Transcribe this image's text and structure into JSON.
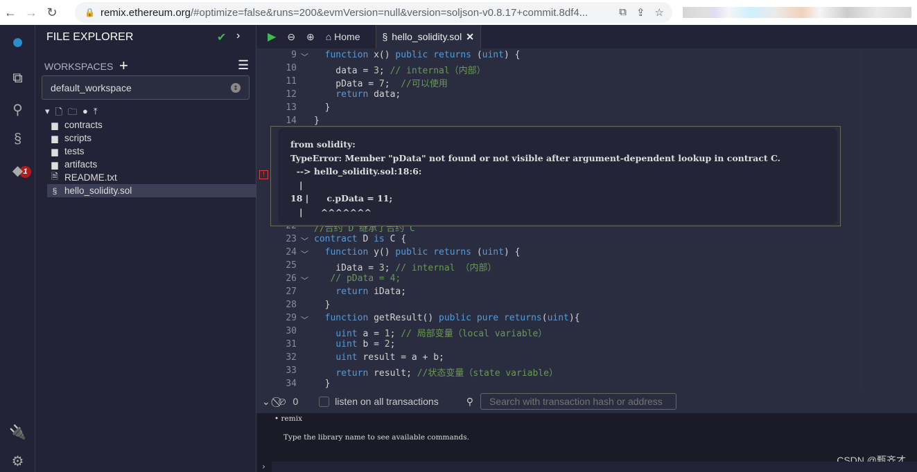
{
  "browser": {
    "url_host": "remix.ethereum.org",
    "url_rest": "/#optimize=false&runs=200&evmVersion=null&version=soljson-v0.8.17+commit.8df4..."
  },
  "iconbar": {
    "badge": "1"
  },
  "explorer": {
    "title": "FILE EXPLORER",
    "workspaces_label": "WORKSPACES",
    "workspace": "default_workspace",
    "items": [
      {
        "name": "contracts",
        "type": "folder"
      },
      {
        "name": "scripts",
        "type": "folder"
      },
      {
        "name": "tests",
        "type": "folder"
      },
      {
        "name": "artifacts",
        "type": "folder"
      },
      {
        "name": "README.txt",
        "type": "file"
      },
      {
        "name": "hello_solidity.sol",
        "type": "sol",
        "selected": true
      }
    ]
  },
  "editor": {
    "home_tab": "Home",
    "active_tab": "hello_solidity.sol",
    "lines": [
      {
        "n": "9",
        "fold": true,
        "t": [
          [
            "  "
          ],
          [
            "function",
            "kw"
          ],
          [
            " x() "
          ],
          [
            "public returns",
            "kw"
          ],
          [
            " ("
          ],
          [
            "uint",
            "kw"
          ],
          [
            ") {"
          ]
        ]
      },
      {
        "n": "10",
        "t": [
          [
            "    data = "
          ],
          [
            "3",
            "num"
          ],
          [
            "; "
          ],
          [
            "// internal（内部）",
            "cm"
          ]
        ]
      },
      {
        "n": "11",
        "t": [
          [
            "    pData = "
          ],
          [
            "7",
            "num"
          ],
          [
            ";  "
          ],
          [
            "//可以使用",
            "cm"
          ]
        ]
      },
      {
        "n": "12",
        "t": [
          [
            "    "
          ],
          [
            "return",
            "kw"
          ],
          [
            " data;"
          ]
        ]
      },
      {
        "n": "13",
        "t": [
          [
            "  }"
          ]
        ]
      },
      {
        "n": "14",
        "t": [
          [
            "}"
          ]
        ]
      },
      {
        "n": "22",
        "t": [
          [
            "//合约 D 继承了合约 C",
            "cm"
          ]
        ]
      },
      {
        "n": "23",
        "fold": true,
        "t": [
          [
            "contract",
            "kw"
          ],
          [
            " D "
          ],
          [
            "is",
            "kw"
          ],
          [
            " C {"
          ]
        ]
      },
      {
        "n": "24",
        "fold": true,
        "t": [
          [
            "  "
          ],
          [
            "function",
            "kw"
          ],
          [
            " y() "
          ],
          [
            "public returns",
            "kw"
          ],
          [
            " ("
          ],
          [
            "uint",
            "kw"
          ],
          [
            ") {"
          ]
        ]
      },
      {
        "n": "25",
        "t": [
          [
            "    iData = "
          ],
          [
            "3",
            "num"
          ],
          [
            "; "
          ],
          [
            "// internal （内部）",
            "cm"
          ]
        ]
      },
      {
        "n": "26",
        "fold": true,
        "t": [
          [
            "   "
          ],
          [
            "// pData = 4;",
            "cm"
          ]
        ]
      },
      {
        "n": "27",
        "t": [
          [
            "    "
          ],
          [
            "return",
            "kw"
          ],
          [
            " iData;"
          ]
        ]
      },
      {
        "n": "28",
        "t": [
          [
            "  }"
          ]
        ]
      },
      {
        "n": "29",
        "fold": true,
        "t": [
          [
            "  "
          ],
          [
            "function",
            "kw"
          ],
          [
            " getResult() "
          ],
          [
            "public pure returns",
            "kw"
          ],
          [
            "("
          ],
          [
            "uint",
            "kw"
          ],
          [
            "){"
          ]
        ]
      },
      {
        "n": "30",
        "t": [
          [
            "    "
          ],
          [
            "uint",
            "kw"
          ],
          [
            " a = "
          ],
          [
            "1",
            "num"
          ],
          [
            "; "
          ],
          [
            "// 局部变量（local variable）",
            "cm"
          ]
        ]
      },
      {
        "n": "31",
        "t": [
          [
            "    "
          ],
          [
            "uint",
            "kw"
          ],
          [
            " b = "
          ],
          [
            "2",
            "num"
          ],
          [
            ";"
          ]
        ]
      },
      {
        "n": "32",
        "t": [
          [
            "    "
          ],
          [
            "uint",
            "kw"
          ],
          [
            " result = a + b;"
          ]
        ]
      },
      {
        "n": "33",
        "t": [
          [
            "    "
          ],
          [
            "return",
            "kw"
          ],
          [
            " result; "
          ],
          [
            "//状态变量（state variable）",
            "cm"
          ]
        ]
      },
      {
        "n": "34",
        "t": [
          [
            "  }"
          ]
        ]
      }
    ]
  },
  "tooltip": {
    "text": "from solidity:\nTypeError: Member \"pData\" not found or not visible after argument-dependent lookup in contract C.\n  --> hello_solidity.sol:18:6:\n   |\n18 |      c.pData = 11;\n   |      ^^^^^^^"
  },
  "terminal": {
    "count": "0",
    "listen_label": "listen on all transactions",
    "search_placeholder": "Search with transaction hash or address",
    "bullet": "remix",
    "help": "Type the library name to see available commands.",
    "watermark": "CSDN @甄齐才"
  }
}
